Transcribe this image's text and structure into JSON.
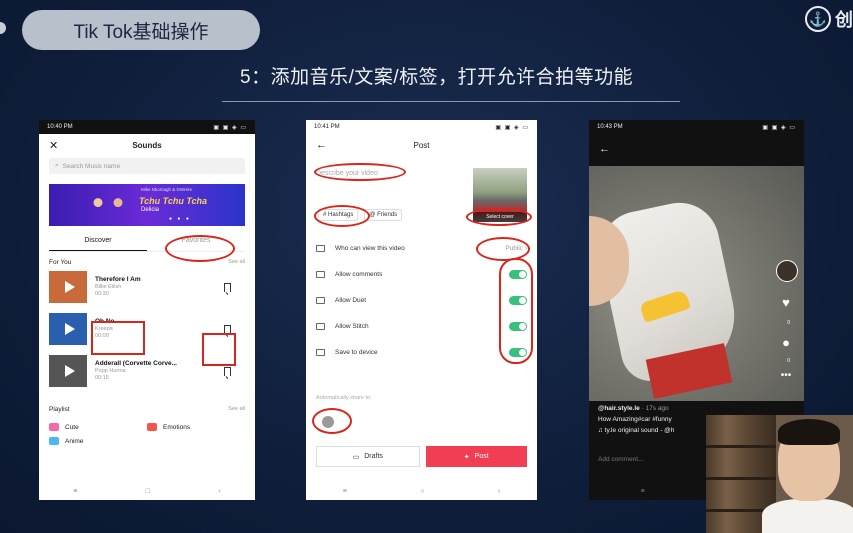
{
  "slide": {
    "title": "Tik Tok基础操作",
    "subtitle": "5：添加音乐/文案/标签，打开允许合拍等功能",
    "brand": "创",
    "brand_icon": "anchor-icon"
  },
  "phone1": {
    "status_time": "10:40 PM",
    "status_icons": "▣ ▣ ◈ ▭",
    "header_title": "Sounds",
    "close_glyph": "✕",
    "search_placeholder": "Search Music name",
    "banner": {
      "credit": "Mike Nkomagh & DWHite",
      "title": "Tchu Tchu Tcha",
      "subtitle": "Delicia",
      "dots": "● ● ●"
    },
    "tabs": [
      "Discover",
      "Favorites"
    ],
    "for_you_label": "For You",
    "see_all": "See all",
    "tracks": [
      {
        "name": "Therefore I Am",
        "artist": "Billie Eilish",
        "duration": "00:30",
        "thumb_color": "#c86a3a"
      },
      {
        "name": "Oh No",
        "artist": "Kreepa",
        "duration": "00:00",
        "thumb_color": "#2a5fb0"
      },
      {
        "name": "Adderall (Corvette Corve...",
        "artist": "Popp Hunna",
        "duration": "00:15",
        "thumb_color": "#555555"
      }
    ],
    "playlist_label": "Playlist",
    "playlist_see_all": "See all",
    "playlist": [
      {
        "label": "Cute",
        "color": "#f26aa8"
      },
      {
        "label": "Emotions",
        "color": "#f2564f"
      }
    ],
    "playlist_next": "Anime",
    "nav": [
      "≡",
      "□",
      "‹"
    ]
  },
  "phone2": {
    "status_time": "10:41 PM",
    "status_icons": "▣ ▣ ◈ ▭",
    "header_title": "Post",
    "back_glyph": "←",
    "describe_placeholder": "Describe your video",
    "select_cover": "Select cover",
    "hashtags_chip": "# Hashtags",
    "friends_chip": "@ Friends",
    "who_can_view": "Who can view this video",
    "who_can_view_value": "Public ›",
    "options": [
      {
        "label": "Allow comments",
        "on": true
      },
      {
        "label": "Allow Duet",
        "on": true
      },
      {
        "label": "Allow Stitch",
        "on": true
      },
      {
        "label": "Save to device",
        "on": true
      }
    ],
    "auto_share": "Automatically share to:",
    "drafts_label": "Drafts",
    "post_label": "Post",
    "nav": [
      "≡",
      "○",
      "‹"
    ]
  },
  "phone3": {
    "status_time": "10:43 PM",
    "status_icons": "▣ ▣ ◈ ▭",
    "back_glyph": "←",
    "username": "@hair.style.le",
    "time_ago": "· 17s ago",
    "caption": "How Amazing#car #funny",
    "sound_line": "♫  ty.le   original sound - @h",
    "add_comment": "Add comment...",
    "like_count": "0",
    "comment_count": "0",
    "nav": [
      "≡",
      "□"
    ]
  }
}
